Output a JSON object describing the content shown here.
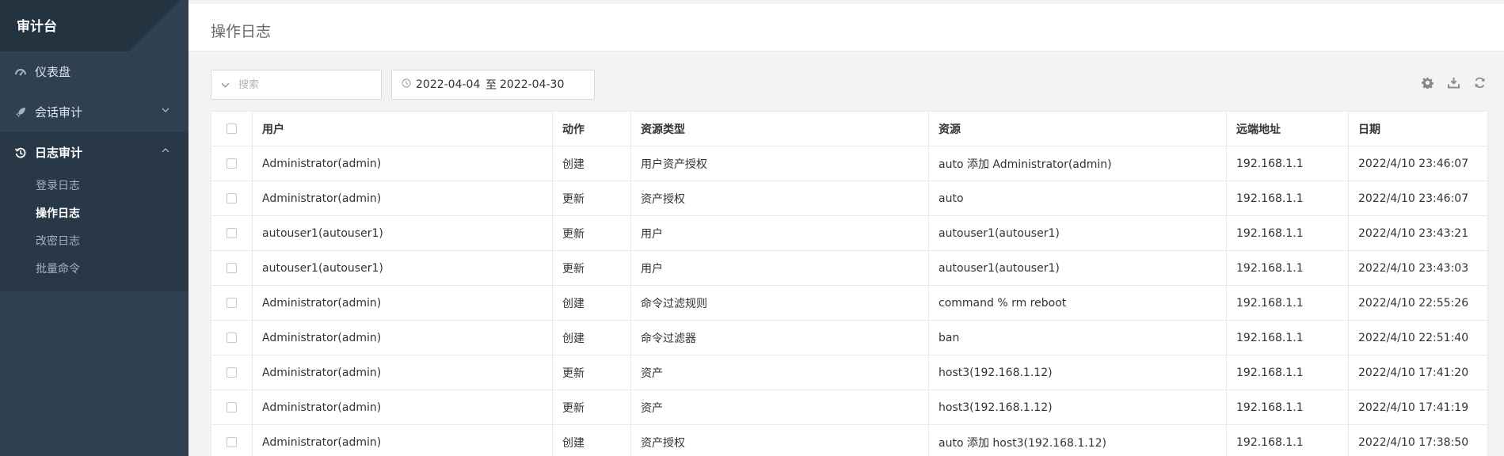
{
  "sidebar": {
    "brand": "审计台",
    "items": [
      {
        "label": "仪表盘",
        "icon": "dashboard-icon"
      },
      {
        "label": "会话审计",
        "icon": "rocket-icon"
      },
      {
        "label": "日志审计",
        "icon": "history-icon"
      }
    ],
    "log_sub_items": [
      "登录日志",
      "操作日志",
      "改密日志",
      "批量命令"
    ],
    "active_sub_item": "操作日志"
  },
  "header": {
    "title": "操作日志"
  },
  "toolbar": {
    "search_placeholder": "搜索",
    "date_start": "2022-04-04",
    "date_sep": "至",
    "date_end": "2022-04-30",
    "tools": [
      "gear-icon",
      "download-icon",
      "refresh-icon"
    ]
  },
  "table": {
    "columns": [
      "用户",
      "动作",
      "资源类型",
      "资源",
      "远端地址",
      "日期"
    ],
    "rows": [
      [
        "Administrator(admin)",
        "创建",
        "用户资产授权",
        "auto 添加 Administrator(admin)",
        "192.168.1.1",
        "2022/4/10 23:46:07"
      ],
      [
        "Administrator(admin)",
        "更新",
        "资产授权",
        "auto",
        "192.168.1.1",
        "2022/4/10 23:46:07"
      ],
      [
        "autouser1(autouser1)",
        "更新",
        "用户",
        "autouser1(autouser1)",
        "192.168.1.1",
        "2022/4/10 23:43:21"
      ],
      [
        "autouser1(autouser1)",
        "更新",
        "用户",
        "autouser1(autouser1)",
        "192.168.1.1",
        "2022/4/10 23:43:03"
      ],
      [
        "Administrator(admin)",
        "创建",
        "命令过滤规则",
        "command % rm reboot",
        "192.168.1.1",
        "2022/4/10 22:55:26"
      ],
      [
        "Administrator(admin)",
        "创建",
        "命令过滤器",
        "ban",
        "192.168.1.1",
        "2022/4/10 22:51:40"
      ],
      [
        "Administrator(admin)",
        "更新",
        "资产",
        "host3(192.168.1.12)",
        "192.168.1.1",
        "2022/4/10 17:41:20"
      ],
      [
        "Administrator(admin)",
        "更新",
        "资产",
        "host3(192.168.1.12)",
        "192.168.1.1",
        "2022/4/10 17:41:19"
      ],
      [
        "Administrator(admin)",
        "创建",
        "资产授权",
        "auto 添加 host3(192.168.1.12)",
        "192.168.1.1",
        "2022/4/10 17:38:50"
      ]
    ]
  },
  "colors": {
    "sidebar_bg": "#2f4050",
    "sidebar_active_bg": "#293846",
    "page_bg": "#f3f3f4"
  }
}
